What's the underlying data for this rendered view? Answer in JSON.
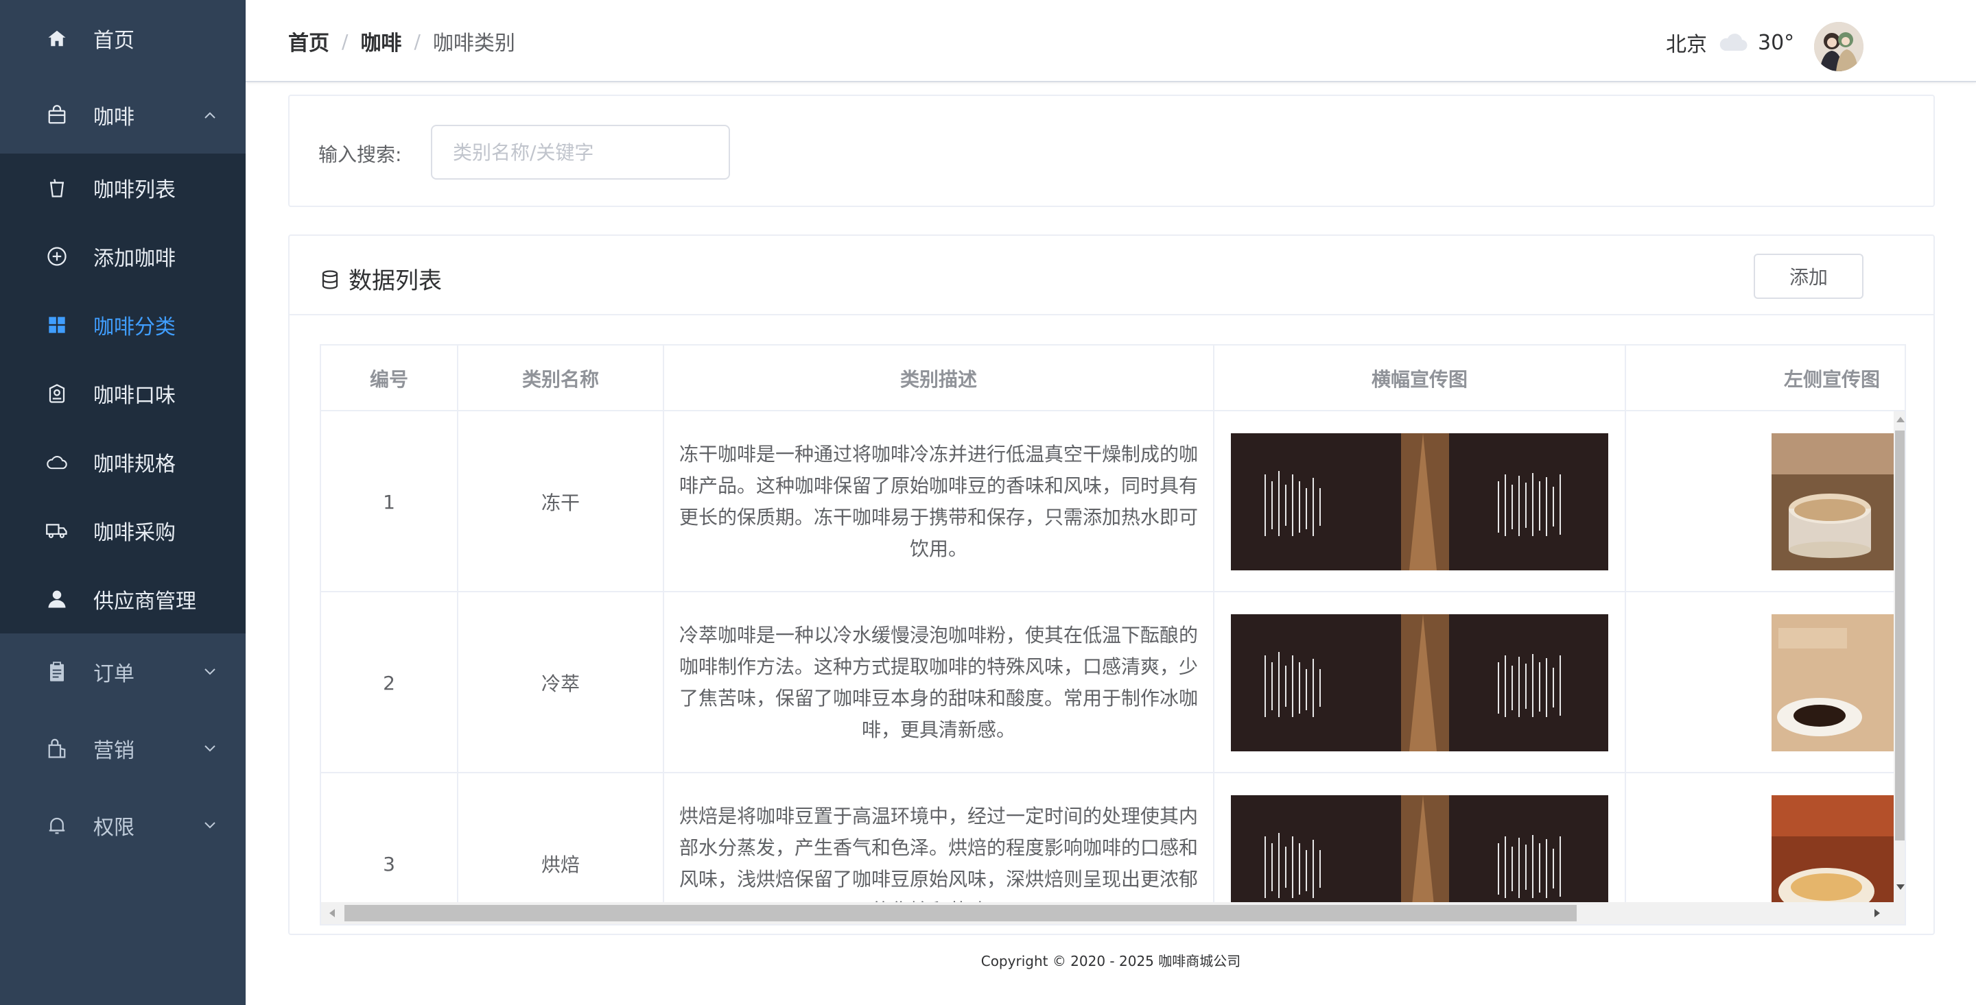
{
  "sidebar": {
    "items": [
      {
        "label": "首页",
        "icon": "home-icon"
      },
      {
        "label": "咖啡",
        "icon": "bag-icon",
        "expanded": true
      },
      {
        "label": "订单",
        "icon": "clipboard-icon"
      },
      {
        "label": "营销",
        "icon": "shopping-bag-icon"
      },
      {
        "label": "权限",
        "icon": "bell-icon"
      }
    ],
    "submenu": [
      {
        "label": "咖啡列表",
        "icon": "cup-icon"
      },
      {
        "label": "添加咖啡",
        "icon": "plus-circle-icon"
      },
      {
        "label": "咖啡分类",
        "icon": "grid-icon",
        "active": true
      },
      {
        "label": "咖啡口味",
        "icon": "location-icon"
      },
      {
        "label": "咖啡规格",
        "icon": "cloud-icon"
      },
      {
        "label": "咖啡采购",
        "icon": "truck-icon"
      },
      {
        "label": "供应商管理",
        "icon": "user-icon"
      }
    ]
  },
  "header": {
    "breadcrumb": [
      "首页",
      "咖啡",
      "咖啡类别"
    ],
    "weather": {
      "city": "北京",
      "temp": "30°"
    }
  },
  "search": {
    "label": "输入搜索:",
    "placeholder": "类别名称/关键字",
    "value": ""
  },
  "card": {
    "title": "数据列表",
    "add_label": "添加"
  },
  "table": {
    "columns": [
      "编号",
      "类别名称",
      "类别描述",
      "横幅宣传图",
      "左侧宣传图"
    ],
    "rows": [
      {
        "id": "1",
        "name": "冻干",
        "desc": "冻干咖啡是一种通过将咖啡冷冻并进行低温真空干燥制成的咖啡产品。这种咖啡保留了原始咖啡豆的香味和风味，同时具有更长的保质期。冻干咖啡易于携带和保存，只需添加热水即可饮用。"
      },
      {
        "id": "2",
        "name": "冷萃",
        "desc": "冷萃咖啡是一种以冷水缓慢浸泡咖啡粉，使其在低温下酝酿的咖啡制作方法。这种方式提取咖啡的特殊风味，口感清爽，少了焦苦味，保留了咖啡豆本身的甜味和酸度。常用于制作冰咖啡，更具清新感。"
      },
      {
        "id": "3",
        "name": "烘焙",
        "desc": "烘焙是将咖啡豆置于高温环境中，经过一定时间的处理使其内部水分蒸发，产生香气和色泽。烘焙的程度影响咖啡的口感和风味，浅烘焙保留了咖啡豆原始风味，深烘焙则呈现出更浓郁的焦糖和苦味。"
      }
    ]
  },
  "footer": {
    "copyright": "Copyright © 2020 - 2025   咖啡商城公司"
  },
  "colors": {
    "sidebar_bg": "#304156",
    "submenu_bg": "#1f2d3d",
    "active": "#409eff"
  }
}
